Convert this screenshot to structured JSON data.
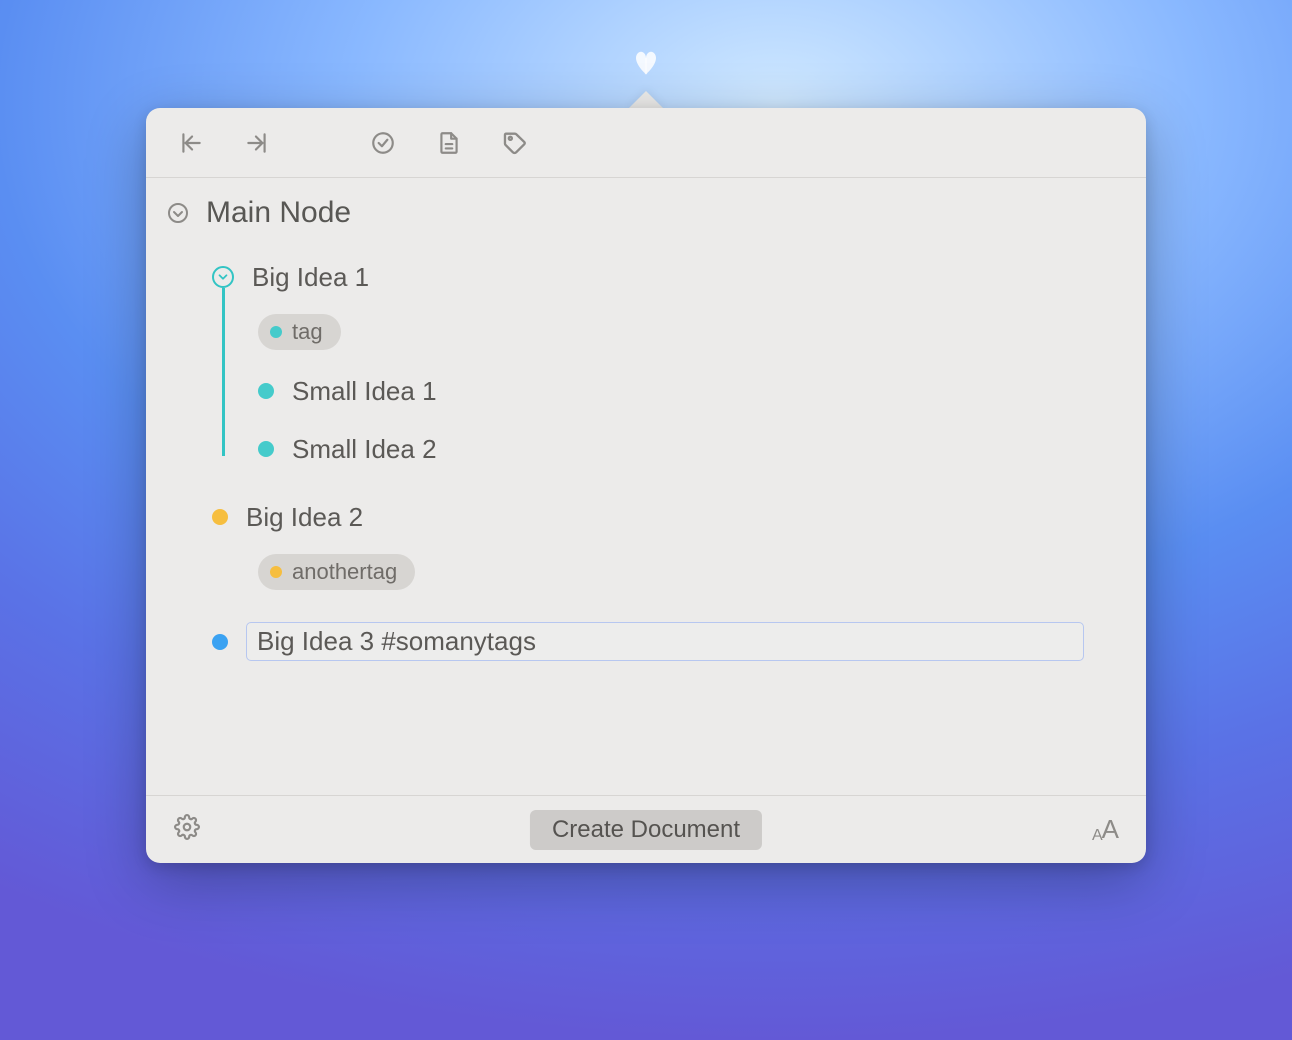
{
  "colors": {
    "teal": "#45cbcb",
    "amber": "#f6be3f",
    "blue": "#3ba2f2"
  },
  "root": {
    "title": "Main Node"
  },
  "nodes": [
    {
      "label": "Big Idea 1",
      "color": "teal",
      "expanded": true,
      "tag": {
        "label": "tag",
        "color": "teal"
      },
      "children": [
        {
          "label": "Small Idea 1",
          "color": "teal"
        },
        {
          "label": "Small Idea 2",
          "color": "teal"
        }
      ]
    },
    {
      "label": "Big Idea 2",
      "color": "amber",
      "tag": {
        "label": "anothertag",
        "color": "amber"
      }
    },
    {
      "label": "Big Idea 3 #somanytags",
      "color": "blue",
      "editing": true
    }
  ],
  "footer": {
    "create_label": "Create Document"
  }
}
